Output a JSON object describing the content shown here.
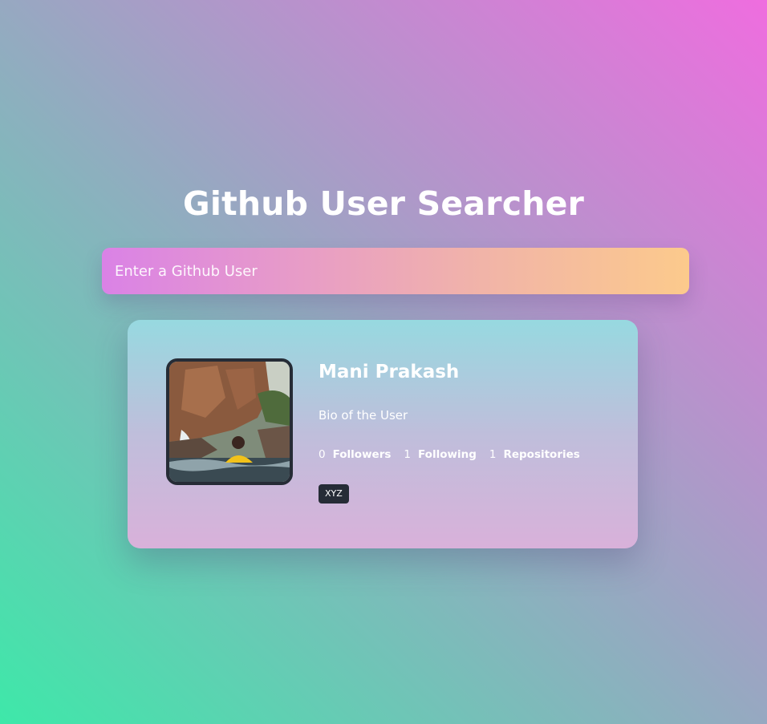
{
  "header": {
    "title": "Github User Searcher"
  },
  "search": {
    "placeholder": "Enter a Github User",
    "value": ""
  },
  "card": {
    "name": "Mani Prakash",
    "bio": "Bio of the User",
    "stats": [
      {
        "count": "0",
        "label": "Followers"
      },
      {
        "count": "1",
        "label": "Following"
      },
      {
        "count": "1",
        "label": "Repositories"
      }
    ],
    "repos": [
      {
        "name": "XYZ"
      }
    ]
  },
  "colors": {
    "background_gradient": [
      "#3ee8a9",
      "#9aa6c2",
      "#ef6ddf"
    ],
    "search_gradient": [
      "#da82e6",
      "#e89dc6",
      "#f1b4a8",
      "#fcca8c"
    ],
    "card_gradient": [
      "#97d9e0",
      "#bfbedb",
      "#d9b1da"
    ],
    "avatar_border": "#262c36",
    "repo_tag_bg": "#262c36",
    "text": "#ffffff"
  }
}
